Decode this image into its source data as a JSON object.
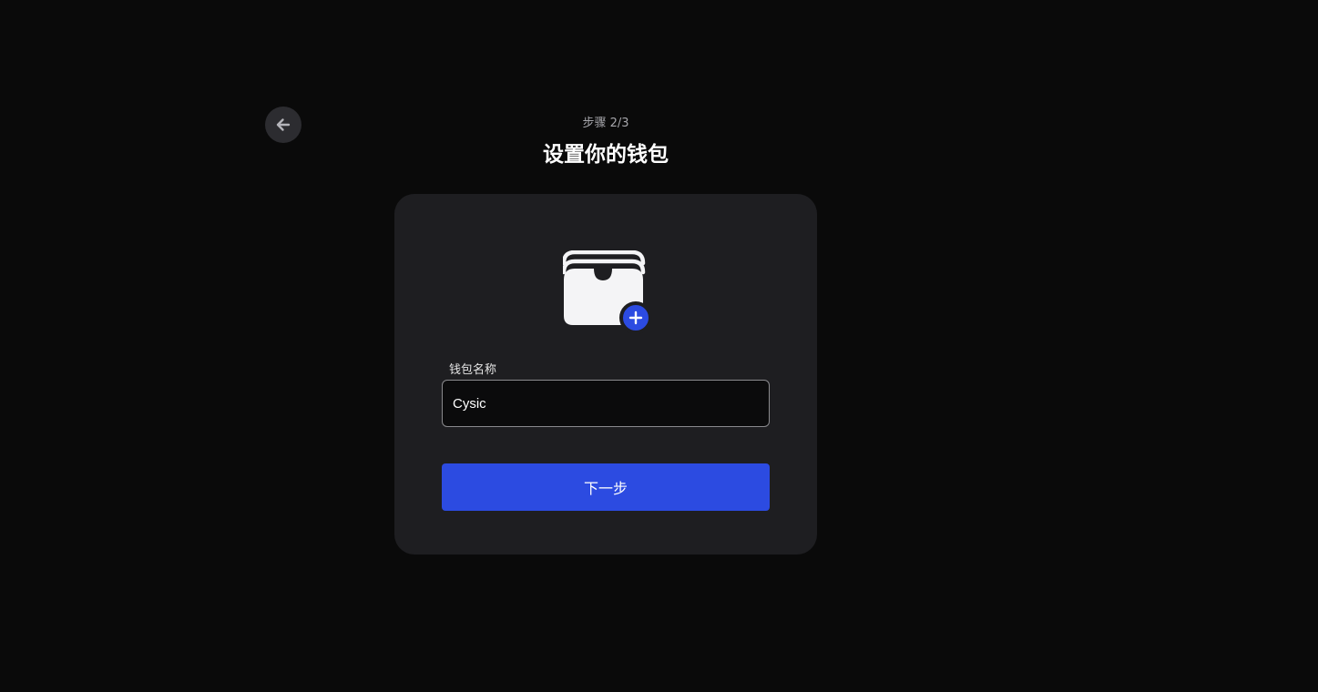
{
  "header": {
    "back_icon": "arrow-left-icon",
    "step": "步骤 2/3",
    "title": "设置你的钱包"
  },
  "card": {
    "wallet_icon": "wallet-icon",
    "add_icon": "plus-icon",
    "field_label": "钱包名称",
    "wallet_name_value": "Cysic",
    "next_label": "下一步"
  },
  "colors": {
    "background": "#0a0a0a",
    "card": "#1e1e21",
    "accent": "#2c4be1",
    "input_border": "#8a8a8e"
  }
}
